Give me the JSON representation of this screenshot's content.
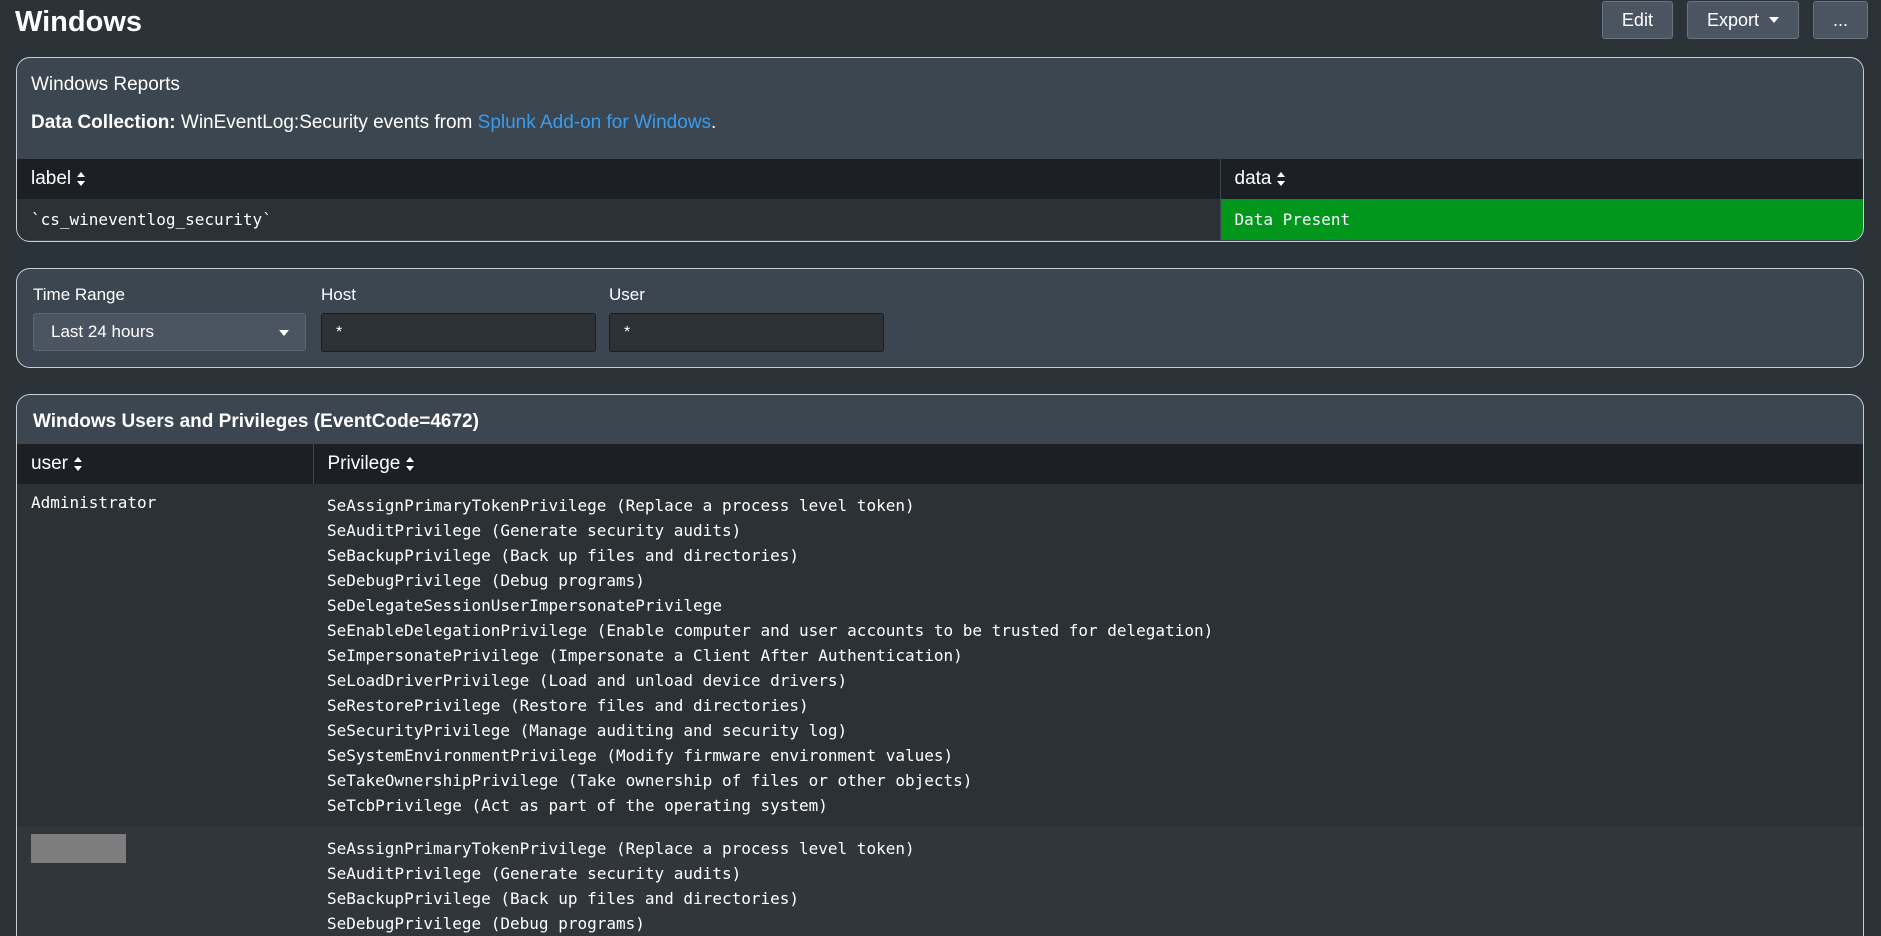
{
  "page": {
    "title": "Windows",
    "edit_label": "Edit",
    "export_label": "Export",
    "more_label": "..."
  },
  "reports_panel": {
    "title": "Windows Reports",
    "collection_bold": "Data Collection:",
    "collection_text": " WinEventLog:Security events from ",
    "collection_link": "Splunk Add-on for Windows",
    "collection_end": ".",
    "columns": [
      "label",
      "data"
    ],
    "row": {
      "label": "`cs_wineventlog_security`",
      "data": "Data Present"
    },
    "present_color": "#00971c"
  },
  "filters": {
    "time_range_label": "Time Range",
    "time_range_value": "Last 24 hours",
    "host_label": "Host",
    "host_value": "*",
    "user_label": "User",
    "user_value": "*"
  },
  "privileges_panel": {
    "title": "Windows Users and Privileges (EventCode=4672)",
    "columns": [
      "user",
      "Privilege"
    ],
    "rows": [
      {
        "user": "Administrator",
        "privileges": [
          "SeAssignPrimaryTokenPrivilege (Replace a process level token)",
          "SeAuditPrivilege (Generate security audits)",
          "SeBackupPrivilege (Back up files and directories)",
          "SeDebugPrivilege (Debug programs)",
          "SeDelegateSessionUserImpersonatePrivilege",
          "SeEnableDelegationPrivilege (Enable computer and user accounts to be trusted for delegation)",
          "SeImpersonatePrivilege (Impersonate a Client After Authentication)",
          "SeLoadDriverPrivilege (Load and unload device drivers)",
          "SeRestorePrivilege (Restore files and directories)",
          "SeSecurityPrivilege (Manage auditing and security log)",
          "SeSystemEnvironmentPrivilege (Modify firmware environment values)",
          "SeTakeOwnershipPrivilege (Take ownership of files or other objects)",
          "SeTcbPrivilege (Act as part of the operating system)"
        ]
      },
      {
        "user": "",
        "privileges": [
          "SeAssignPrimaryTokenPrivilege (Replace a process level token)",
          "SeAuditPrivilege (Generate security audits)",
          "SeBackupPrivilege (Back up files and directories)",
          "SeDebugPrivilege (Debug programs)"
        ]
      }
    ]
  }
}
